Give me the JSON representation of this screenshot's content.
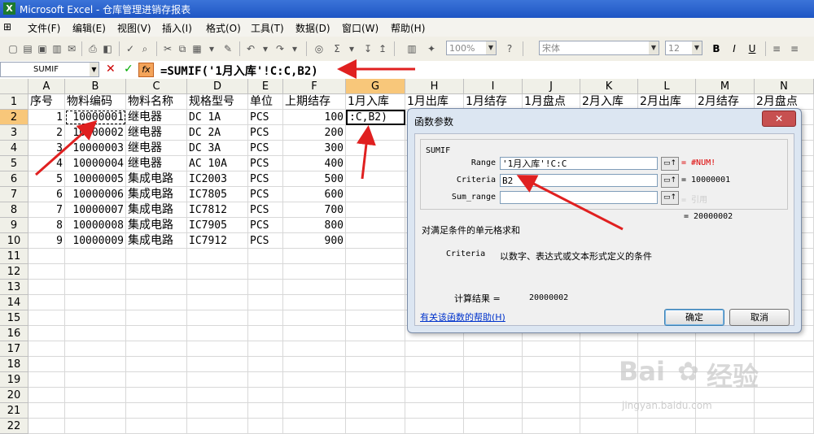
{
  "window": {
    "title": "Microsoft Excel - 仓库管理进销存报表",
    "app_icon": "excel-icon"
  },
  "menu": [
    "文件(F)",
    "编辑(E)",
    "视图(V)",
    "插入(I)",
    "格式(O)",
    "工具(T)",
    "数据(D)",
    "窗口(W)",
    "帮助(H)"
  ],
  "toolbar": {
    "zoom": "100%",
    "font_name": "宋体",
    "font_size": "12",
    "bold": "B",
    "italic": "I",
    "underline": "U"
  },
  "formula_bar": {
    "name_box": "SUMIF",
    "cancel": "✕",
    "enter": "✓",
    "fx": "fx",
    "formula": "=SUMIF('1月入库'!C:C,B2)"
  },
  "sheet": {
    "columns": [
      "A",
      "B",
      "C",
      "D",
      "E",
      "F",
      "G",
      "H",
      "I",
      "J",
      "K",
      "L",
      "M",
      "N"
    ],
    "header_row": [
      "序号",
      "物料编码",
      "物料名称",
      "规格型号",
      "单位",
      "上期结存",
      "1月入库",
      "1月出库",
      "1月结存",
      "1月盘点",
      "2月入库",
      "2月出库",
      "2月结存",
      "2月盘点"
    ],
    "rows": [
      [
        "1",
        "10000001",
        "继电器",
        "DC 1A",
        "PCS",
        "100",
        ":C,B2)"
      ],
      [
        "2",
        "10000002",
        "继电器",
        "DC 2A",
        "PCS",
        "200",
        ""
      ],
      [
        "3",
        "10000003",
        "继电器",
        "DC 3A",
        "PCS",
        "300",
        ""
      ],
      [
        "4",
        "10000004",
        "继电器",
        "AC 10A",
        "PCS",
        "400",
        ""
      ],
      [
        "5",
        "10000005",
        "集成电路",
        "IC2003",
        "PCS",
        "500",
        ""
      ],
      [
        "6",
        "10000006",
        "集成电路",
        "IC7805",
        "PCS",
        "600",
        ""
      ],
      [
        "7",
        "10000007",
        "集成电路",
        "IC7812",
        "PCS",
        "700",
        ""
      ],
      [
        "8",
        "10000008",
        "集成电路",
        "IC7905",
        "PCS",
        "800",
        ""
      ],
      [
        "9",
        "10000009",
        "集成电路",
        "IC7912",
        "PCS",
        "900",
        ""
      ]
    ],
    "row_numbers": [
      "1",
      "2",
      "3",
      "4",
      "5",
      "6",
      "7",
      "8",
      "9",
      "10",
      "11",
      "12",
      "13",
      "14",
      "15",
      "16",
      "17",
      "18",
      "19",
      "20",
      "21",
      "22"
    ]
  },
  "dialog": {
    "title": "函数参数",
    "close": "✕",
    "function_name": "SUMIF",
    "args": [
      {
        "label": "Range",
        "value": "'1月入库'!C:C",
        "result": "= #NUM!"
      },
      {
        "label": "Criteria",
        "value": "B2",
        "result": "= 10000001"
      },
      {
        "label": "Sum_range",
        "value": "",
        "result": "= 引用"
      }
    ],
    "total_result": "= 20000002",
    "description": "对满足条件的单元格求和",
    "arg_help_name": "Criteria",
    "arg_help_text": "以数字、表达式或文本形式定义的条件",
    "calc_label": "计算结果 =",
    "calc_value": "20000002",
    "help_link": "有关该函数的帮助(H)",
    "ok": "确定",
    "cancel": "取消"
  },
  "watermark": {
    "line1": "Bai",
    "line2": "jingyan.baidu.com",
    "logo": "paw-icon",
    "brand": "经验"
  },
  "colors": {
    "arrow": "#e02020",
    "selected_header": "#f8c77a",
    "title_bar": "#2a62cc"
  }
}
